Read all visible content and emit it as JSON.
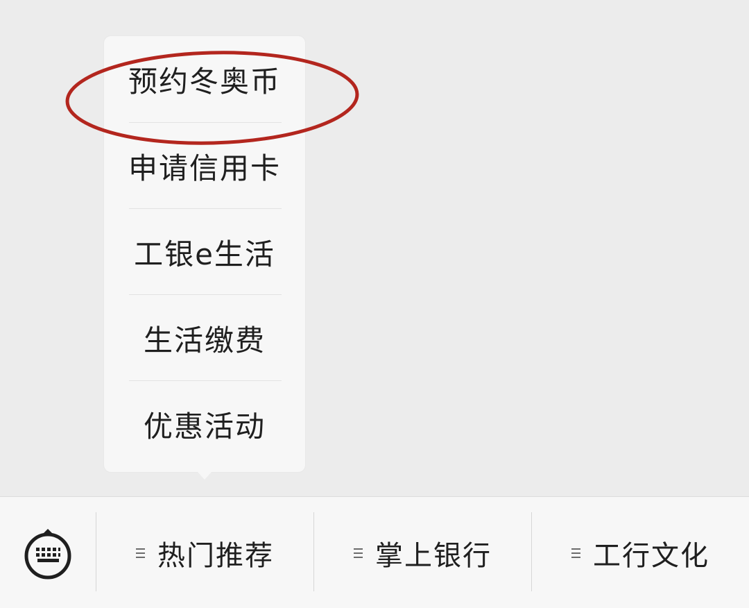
{
  "popup": {
    "items": [
      {
        "label": "预约冬奥币"
      },
      {
        "label": "申请信用卡"
      },
      {
        "label": "工银e生活"
      },
      {
        "label": "生活缴费"
      },
      {
        "label": "优惠活动"
      }
    ]
  },
  "menubar": {
    "keyboard_icon": "keyboard-icon",
    "tabs": [
      {
        "label": "热门推荐",
        "icon": "menu-lines-icon"
      },
      {
        "label": "掌上银行",
        "icon": "menu-lines-icon"
      },
      {
        "label": "工行文化",
        "icon": "menu-lines-icon"
      }
    ]
  },
  "annotation": {
    "color": "#b3261e"
  }
}
